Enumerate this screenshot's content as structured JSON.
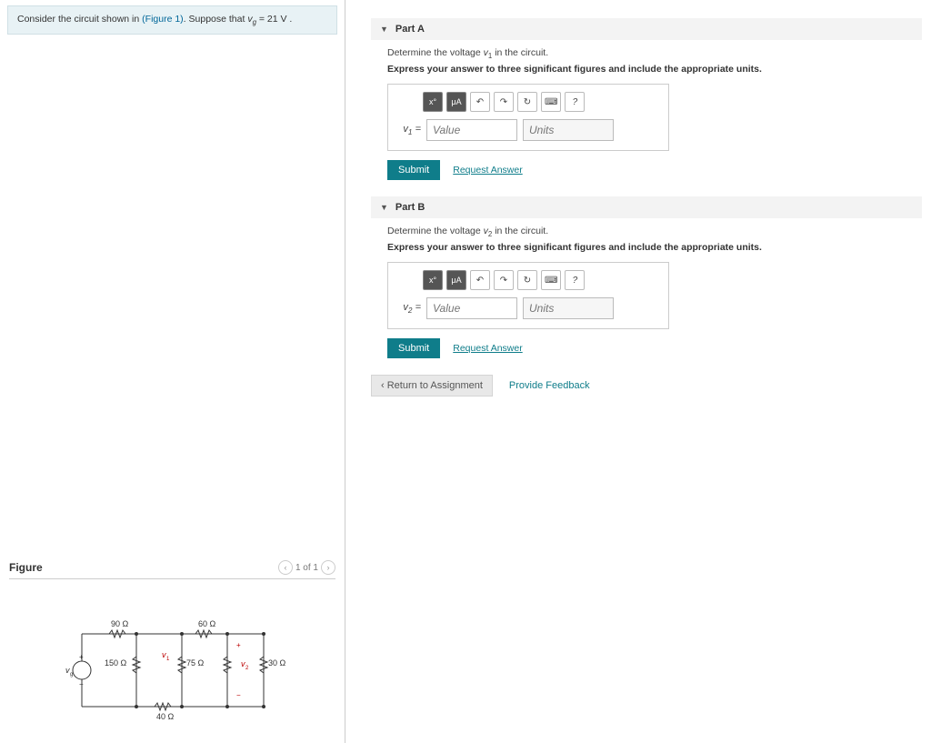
{
  "problem": {
    "text_prefix": "Consider the circuit shown in ",
    "figure_link": "(Figure 1)",
    "text_suffix": ". Suppose that ",
    "var_html": "v_g",
    "equals": " = 21  V ."
  },
  "figure": {
    "title": "Figure",
    "pager_label": "1 of 1"
  },
  "circuit": {
    "R_top_left": "90 Ω",
    "R_top_right": "60 Ω",
    "R_left": "150 Ω",
    "R_mid": "75 Ω",
    "R_right": "30 Ω",
    "R_bottom": "40 Ω",
    "vg": "v_g",
    "v1": "v_1",
    "v2": "v_2",
    "plus": "+",
    "minus": "−"
  },
  "parts": [
    {
      "title": "Part A",
      "question": "Determine the voltage v₁ in the circuit.",
      "instruction": "Express your answer to three significant figures and include the appropriate units.",
      "var_label": "v₁ =",
      "value_placeholder": "Value",
      "units_placeholder": "Units",
      "submit": "Submit",
      "request": "Request Answer"
    },
    {
      "title": "Part B",
      "question": "Determine the voltage v₂ in the circuit.",
      "instruction": "Express your answer to three significant figures and include the appropriate units.",
      "var_label": "v₂ =",
      "value_placeholder": "Value",
      "units_placeholder": "Units",
      "submit": "Submit",
      "request": "Request Answer"
    }
  ],
  "toolbar": {
    "templates_icon": "x°",
    "units_icon": "μA",
    "undo_icon": "↶",
    "redo_icon": "↷",
    "reset_icon": "↻",
    "keyboard_icon": "⌨",
    "help_icon": "?"
  },
  "footer": {
    "return": "Return to Assignment",
    "feedback": "Provide Feedback"
  }
}
